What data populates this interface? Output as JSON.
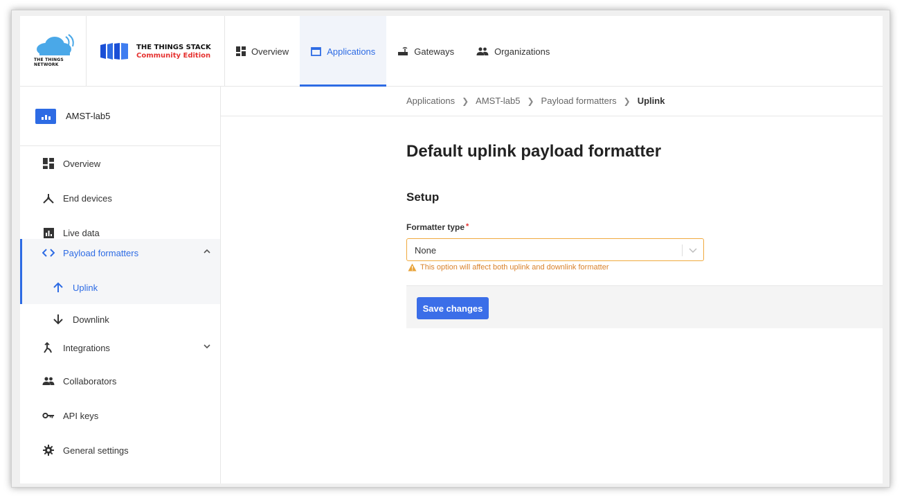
{
  "brand": {
    "ttn_line1": "THE THINGS",
    "ttn_line2": "NETWORK",
    "stack_title": "THE THINGS STACK",
    "stack_subtitle": "Community Edition",
    "colors": {
      "accent": "#2d6be4",
      "brand_red": "#e5312f",
      "cloud": "#4aa8e8"
    }
  },
  "top_nav": [
    {
      "label": "Overview",
      "icon": "grid-icon",
      "active": false
    },
    {
      "label": "Applications",
      "icon": "window-icon",
      "active": true
    },
    {
      "label": "Gateways",
      "icon": "router-icon",
      "active": false
    },
    {
      "label": "Organizations",
      "icon": "people-icon",
      "active": false
    }
  ],
  "sidebar": {
    "app_name": "AMST-lab5",
    "items": [
      {
        "label": "Overview",
        "icon": "grid-icon"
      },
      {
        "label": "End devices",
        "icon": "devices-icon"
      },
      {
        "label": "Live data",
        "icon": "chart-icon"
      },
      {
        "label": "Payload formatters",
        "icon": "code-icon"
      },
      {
        "label": "Uplink",
        "icon": "arrow-up-icon"
      },
      {
        "label": "Downlink",
        "icon": "arrow-down-icon"
      },
      {
        "label": "Integrations",
        "icon": "merge-icon"
      },
      {
        "label": "Collaborators",
        "icon": "people-icon"
      },
      {
        "label": "API keys",
        "icon": "key-icon"
      },
      {
        "label": "General settings",
        "icon": "gear-icon"
      }
    ]
  },
  "breadcrumb": [
    "Applications",
    "AMST-lab5",
    "Payload formatters",
    "Uplink"
  ],
  "main": {
    "title": "Default uplink payload formatter",
    "section": "Setup",
    "field_label": "Formatter type",
    "required_mark": "*",
    "select_value": "None",
    "warning": "This option will affect both uplink and downlink formatter",
    "save_label": "Save changes",
    "colors": {
      "warning": "#d9822b",
      "button": "#3b6ee8"
    }
  }
}
